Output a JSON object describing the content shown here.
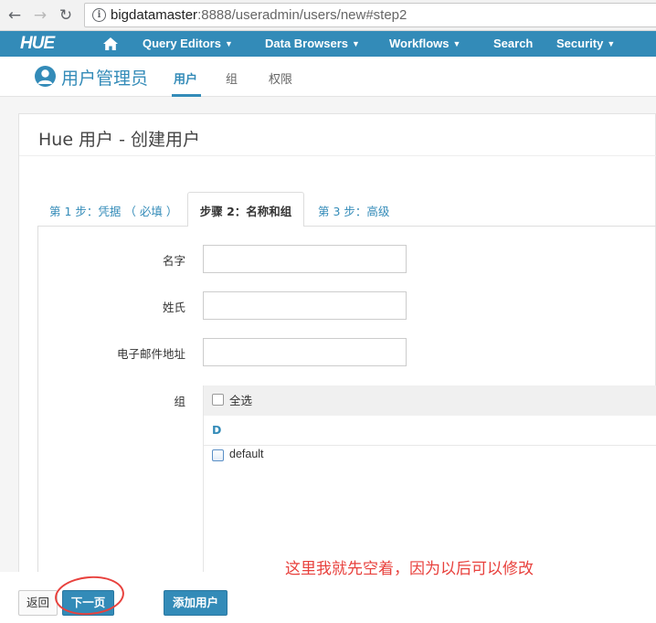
{
  "browser": {
    "url_host": "bigdatamaster",
    "url_rest": ":8888/useradmin/users/new#step2",
    "back_glyph": "←",
    "forward_glyph": "→",
    "reload_glyph": "↻",
    "info_glyph": "i"
  },
  "navbar": {
    "logo": "HUE",
    "items": [
      {
        "label": "Query Editors",
        "caret": "▼"
      },
      {
        "label": "Data Browsers",
        "caret": "▼"
      },
      {
        "label": "Workflows",
        "caret": "▼"
      },
      {
        "label": "Search"
      },
      {
        "label": "Security",
        "caret": "▼"
      }
    ],
    "background": "#338bb8"
  },
  "subheader": {
    "title": "用户管理员",
    "tabs": [
      {
        "label": "用户",
        "active": true
      },
      {
        "label": "组"
      },
      {
        "label": "权限"
      }
    ]
  },
  "card": {
    "title": "Hue 用户 - 创建用户"
  },
  "wizard": {
    "tabs": [
      {
        "label": "第 1 步：凭据 （ 必填 ）"
      },
      {
        "label": "步骤 2：名称和组",
        "active": true
      },
      {
        "label": "第 3 步：高级"
      }
    ]
  },
  "form": {
    "first_name_label": "名字",
    "first_name_value": "",
    "last_name_label": "姓氏",
    "last_name_value": "",
    "email_label": "电子邮件地址",
    "email_value": "",
    "groups_label": "组",
    "select_all_label": "全选",
    "group_letter": "D",
    "groups": [
      {
        "name": "default",
        "checked": false
      }
    ]
  },
  "footer": {
    "back_label": "返回",
    "next_label": "下一页",
    "add_user_label": "添加用户"
  },
  "annotation": {
    "text": "这里我就先空着，因为以后可以修改",
    "color": "#e8413d"
  }
}
